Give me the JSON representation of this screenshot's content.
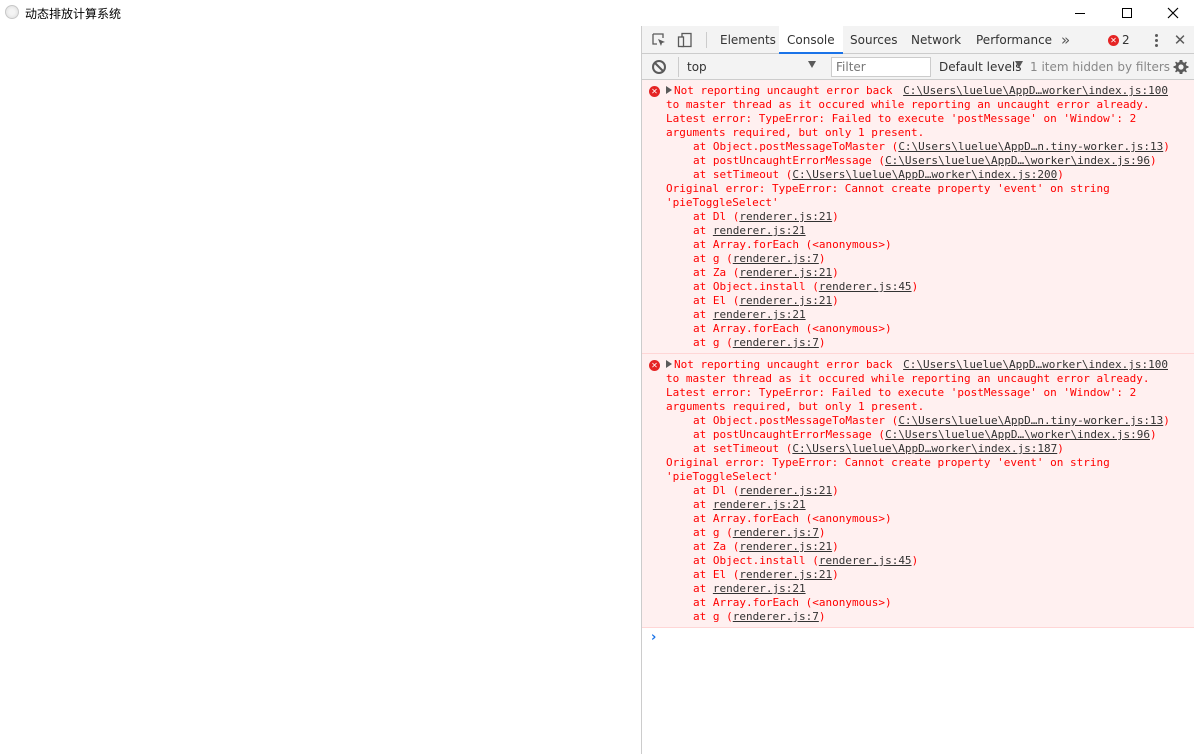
{
  "window": {
    "title": "动态排放计算系统",
    "minimize_label": "",
    "maximize_label": "",
    "close_label": "✕"
  },
  "devtools": {
    "tabs": [
      {
        "label": "Elements",
        "active": false
      },
      {
        "label": "Console",
        "active": true
      },
      {
        "label": "Sources",
        "active": false
      },
      {
        "label": "Network",
        "active": false
      },
      {
        "label": "Performance",
        "active": false
      }
    ],
    "more_tabs": "»",
    "error_count": "2",
    "close_label": "✕"
  },
  "toolbar": {
    "context": "top",
    "filter_placeholder": "Filter",
    "levels": "Default levels",
    "hidden": "1 item hidden by filters"
  },
  "colors": {
    "error_text": "#ff0000",
    "error_bg": "#fff0f0",
    "accent": "#1a73e8"
  },
  "messages": [
    {
      "source": "C:\\Users\\luelue\\AppD…worker\\index.js:100",
      "header": "Not reporting uncaught error back",
      "lines": [
        {
          "text": "to master thread as it occured while reporting an uncaught error already.",
          "indent": false
        },
        {
          "text": "Latest error: TypeError: Failed to execute 'postMessage' on 'Window': 2",
          "indent": false
        },
        {
          "text": "arguments required, but only 1 present.",
          "indent": false
        },
        {
          "pre": "at Object.postMessageToMaster (",
          "link": "C:\\Users\\luelue\\AppD…n.tiny-worker.js:13",
          "post": ")",
          "indent": true
        },
        {
          "pre": "at postUncaughtErrorMessage (",
          "link": "C:\\Users\\luelue\\AppD…\\worker\\index.js:96",
          "post": ")",
          "indent": true
        },
        {
          "pre": "at setTimeout (",
          "link": "C:\\Users\\luelue\\AppD…worker\\index.js:200",
          "post": ")",
          "indent": true
        },
        {
          "text": "Original error: TypeError: Cannot create property 'event' on string",
          "indent": false
        },
        {
          "text": "'pieToggleSelect'",
          "indent": false
        },
        {
          "pre": "at Dl (",
          "link": "renderer.js:21",
          "post": ")",
          "indent": true
        },
        {
          "pre": "at ",
          "link": "renderer.js:21",
          "post": "",
          "indent": true
        },
        {
          "text": "at Array.forEach (<anonymous>)",
          "indent": true
        },
        {
          "pre": "at g (",
          "link": "renderer.js:7",
          "post": ")",
          "indent": true
        },
        {
          "pre": "at Za (",
          "link": "renderer.js:21",
          "post": ")",
          "indent": true
        },
        {
          "pre": "at Object.install (",
          "link": "renderer.js:45",
          "post": ")",
          "indent": true
        },
        {
          "pre": "at El (",
          "link": "renderer.js:21",
          "post": ")",
          "indent": true
        },
        {
          "pre": "at ",
          "link": "renderer.js:21",
          "post": "",
          "indent": true
        },
        {
          "text": "at Array.forEach (<anonymous>)",
          "indent": true
        },
        {
          "pre": "at g (",
          "link": "renderer.js:7",
          "post": ")",
          "indent": true
        }
      ]
    },
    {
      "source": "C:\\Users\\luelue\\AppD…worker\\index.js:100",
      "header": "Not reporting uncaught error back",
      "lines": [
        {
          "text": "to master thread as it occured while reporting an uncaught error already.",
          "indent": false
        },
        {
          "text": "Latest error: TypeError: Failed to execute 'postMessage' on 'Window': 2",
          "indent": false
        },
        {
          "text": "arguments required, but only 1 present.",
          "indent": false
        },
        {
          "pre": "at Object.postMessageToMaster (",
          "link": "C:\\Users\\luelue\\AppD…n.tiny-worker.js:13",
          "post": ")",
          "indent": true
        },
        {
          "pre": "at postUncaughtErrorMessage (",
          "link": "C:\\Users\\luelue\\AppD…\\worker\\index.js:96",
          "post": ")",
          "indent": true
        },
        {
          "pre": "at setTimeout (",
          "link": "C:\\Users\\luelue\\AppD…worker\\index.js:187",
          "post": ")",
          "indent": true
        },
        {
          "text": "Original error: TypeError: Cannot create property 'event' on string",
          "indent": false
        },
        {
          "text": "'pieToggleSelect'",
          "indent": false
        },
        {
          "pre": "at Dl (",
          "link": "renderer.js:21",
          "post": ")",
          "indent": true
        },
        {
          "pre": "at ",
          "link": "renderer.js:21",
          "post": "",
          "indent": true
        },
        {
          "text": "at Array.forEach (<anonymous>)",
          "indent": true
        },
        {
          "pre": "at g (",
          "link": "renderer.js:7",
          "post": ")",
          "indent": true
        },
        {
          "pre": "at Za (",
          "link": "renderer.js:21",
          "post": ")",
          "indent": true
        },
        {
          "pre": "at Object.install (",
          "link": "renderer.js:45",
          "post": ")",
          "indent": true
        },
        {
          "pre": "at El (",
          "link": "renderer.js:21",
          "post": ")",
          "indent": true
        },
        {
          "pre": "at ",
          "link": "renderer.js:21",
          "post": "",
          "indent": true
        },
        {
          "text": "at Array.forEach (<anonymous>)",
          "indent": true
        },
        {
          "pre": "at g (",
          "link": "renderer.js:7",
          "post": ")",
          "indent": true
        }
      ]
    }
  ],
  "prompt": "›"
}
